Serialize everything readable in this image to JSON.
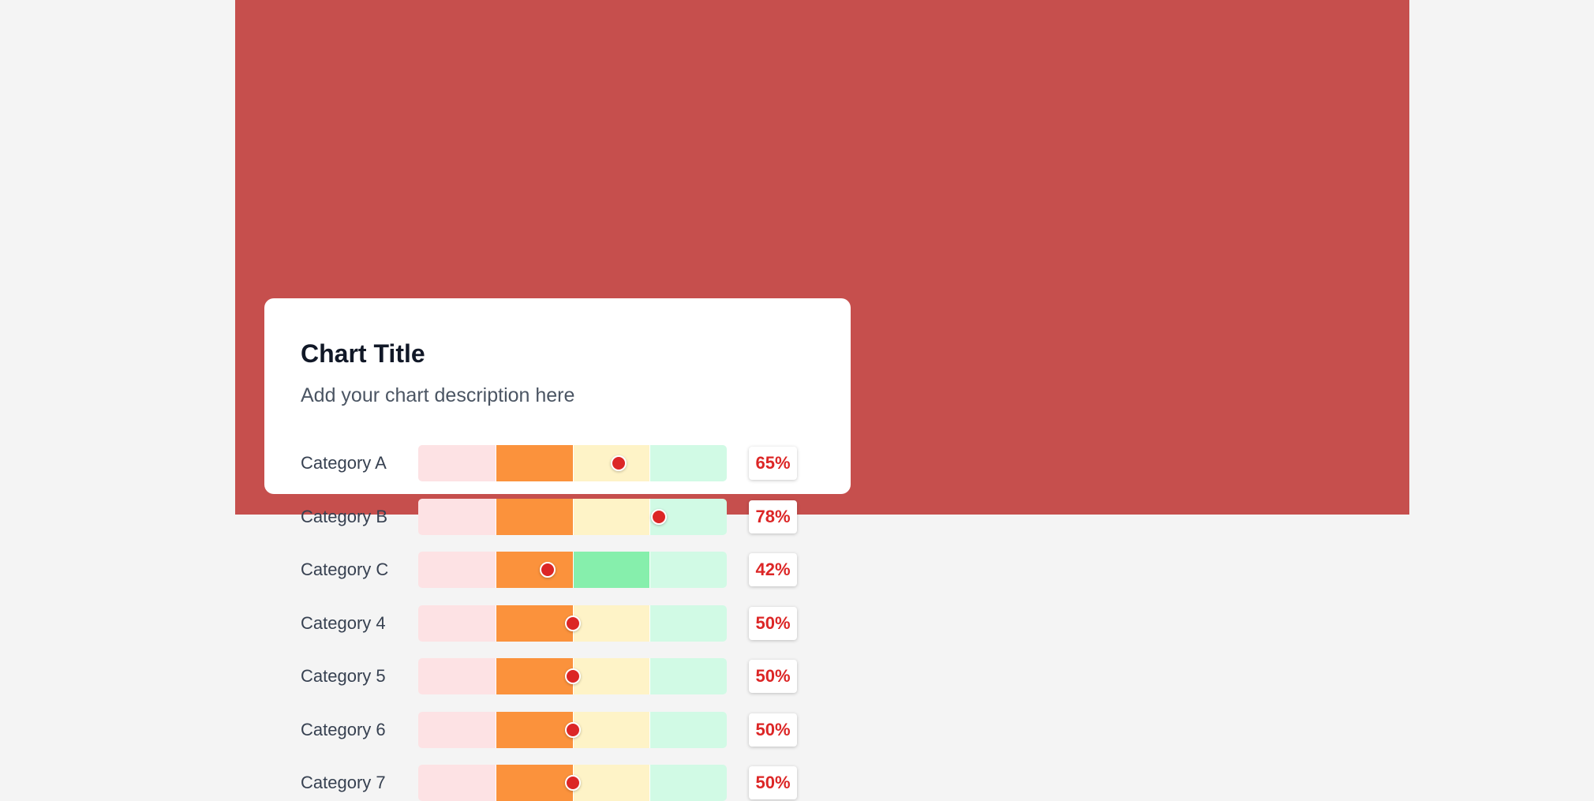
{
  "chart": {
    "title": "Chart Title",
    "description": "Add your chart description here"
  },
  "colors": {
    "hero_background": "#c64f4d",
    "marker": "#dc2626",
    "zone_1": "#fde2e4",
    "zone_2": "#fb923c",
    "zone_3": "#fef3c7",
    "zone_4": "#d1fae5",
    "zone_3_highlight": "#86efac"
  },
  "chart_data": {
    "type": "bar",
    "title": "Chart Title",
    "subtitle": "Add your chart description here",
    "xlim": [
      0,
      100
    ],
    "zones": [
      0,
      25,
      50,
      75,
      100
    ],
    "categories": [
      "Category A",
      "Category B",
      "Category C",
      "Category 4",
      "Category 5",
      "Category 6",
      "Category 7"
    ],
    "values": [
      65,
      78,
      42,
      50,
      50,
      50,
      50
    ],
    "value_labels": [
      "65%",
      "78%",
      "42%",
      "50%",
      "50%",
      "50%",
      "50%"
    ],
    "highlighted_zone": [
      null,
      null,
      2,
      null,
      null,
      null,
      null
    ]
  }
}
